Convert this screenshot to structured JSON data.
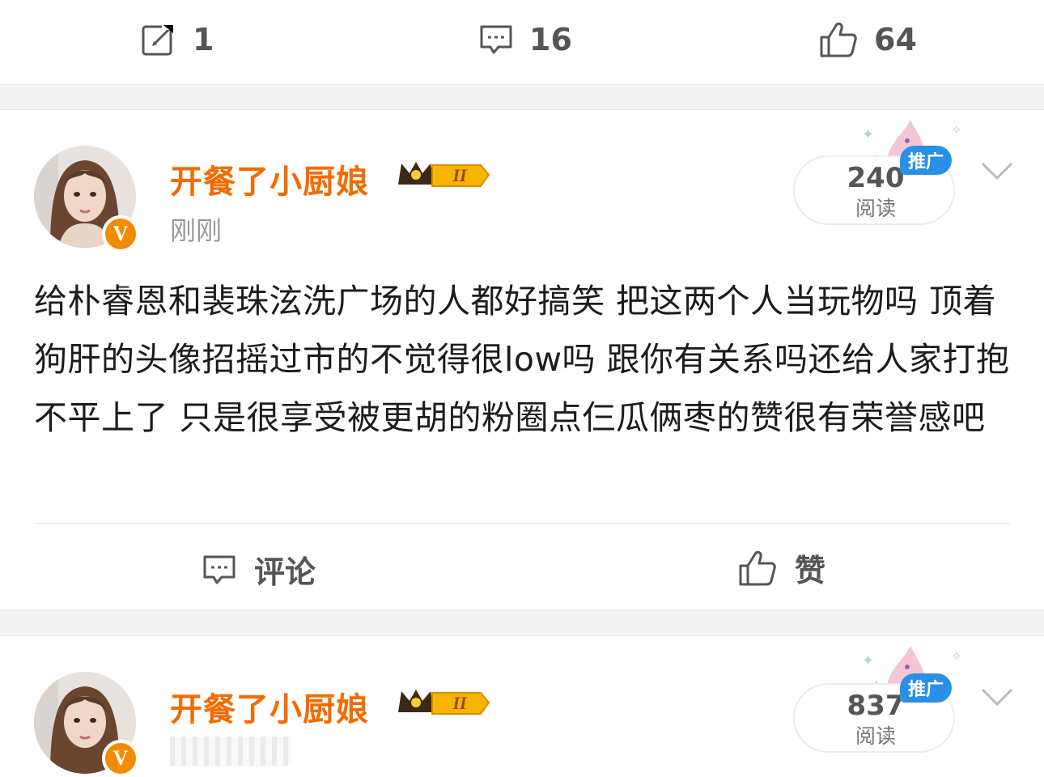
{
  "top_actions": {
    "repost_count": "1",
    "comment_count": "16",
    "like_count": "64"
  },
  "posts": [
    {
      "username": "开餐了小厨娘",
      "level_badge": "II",
      "time": "刚刚",
      "verified_mark": "V",
      "promo": {
        "count": "240",
        "label": "阅读",
        "tag": "推广"
      },
      "content": "给朴睿恩和裴珠泫洗广场的人都好搞笑 把这两个人当玩物吗 顶着狗肝的头像招摇过市的不觉得很low吗 跟你有关系吗还给人家打抱不平上了 只是很享受被更胡的粉圈点仨瓜俩枣的赞很有荣誉感吧",
      "actions": {
        "comment_label": "评论",
        "like_label": "赞"
      }
    },
    {
      "username": "开餐了小厨娘",
      "level_badge": "II",
      "verified_mark": "V",
      "promo": {
        "count": "837",
        "label": "阅读",
        "tag": "推广"
      }
    }
  ],
  "icons": {
    "repost": "repost-icon",
    "comment": "comment-icon",
    "like": "like-icon",
    "chevron": "chevron-down-icon",
    "crown": "crown-badge-icon"
  },
  "colors": {
    "username": "#f36b00",
    "verified": "#f28b00",
    "promo_tag": "#2a8fe6",
    "divider_band": "#f2f2f2"
  }
}
